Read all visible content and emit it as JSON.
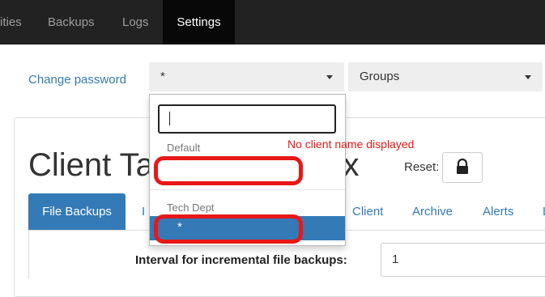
{
  "nav": {
    "items": [
      "ities",
      "Backups",
      "Logs",
      "Settings"
    ]
  },
  "topbar": {
    "change_password": "Change password",
    "client_select": "*",
    "groups_select": "Groups"
  },
  "page": {
    "title": "Client Ta",
    "title_suffix": "mox",
    "reset_label": "Reset:"
  },
  "tabs": [
    "File Backups",
    "I",
    "Client",
    "Archive",
    "Alerts",
    "L"
  ],
  "field": {
    "label": "Interval for incremental file backups:",
    "value": "1"
  },
  "dropdown": {
    "search_value": "",
    "groups": [
      {
        "label": "Default",
        "items": [
          ""
        ]
      },
      {
        "label": "Tech Dept",
        "items": [
          "*"
        ]
      }
    ]
  },
  "annotation": {
    "text": "No client name displayed",
    "color": "#e81818"
  },
  "colors": {
    "navbar": "#222222",
    "accent": "#337ab7"
  }
}
